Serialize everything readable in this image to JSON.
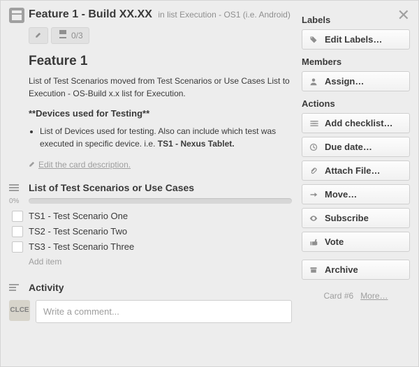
{
  "header": {
    "title": "Feature 1 - Build XX.XX",
    "in_list_prefix": "in list",
    "list_name": "Execution - OS1 (i.e. Android)"
  },
  "badges": {
    "checklist": "0/3"
  },
  "description": {
    "title": "Feature 1",
    "body": "List of Test Scenarios moved from Test Scenarios or Use Cases List to Execution - OS-Build x.x list for Execution.",
    "devices_heading": "**Devices used for Testing**",
    "devices_item_prefix": "List of Devices used for testing. Also can include which test was executed in specific device. i.e. ",
    "devices_item_bold": "TS1 - Nexus Tablet.",
    "edit_link": "Edit the card description."
  },
  "checklist": {
    "title": "List of Test Scenarios or Use Cases",
    "percent": "0%",
    "items": [
      {
        "label": "TS1 - Test Scenario One"
      },
      {
        "label": "TS2 - Test Scenario Two"
      },
      {
        "label": "TS3 - Test Scenario Three"
      }
    ],
    "add_item": "Add item"
  },
  "activity": {
    "title": "Activity",
    "avatar": "CLCE",
    "comment_placeholder": "Write a comment..."
  },
  "sidebar": {
    "labels_h": "Labels",
    "edit_labels": "Edit Labels…",
    "members_h": "Members",
    "assign": "Assign…",
    "actions_h": "Actions",
    "add_checklist": "Add checklist…",
    "due_date": "Due date…",
    "attach": "Attach File…",
    "move": "Move…",
    "subscribe": "Subscribe",
    "vote": "Vote",
    "archive": "Archive",
    "card_num": "Card #6",
    "more": "More…"
  }
}
